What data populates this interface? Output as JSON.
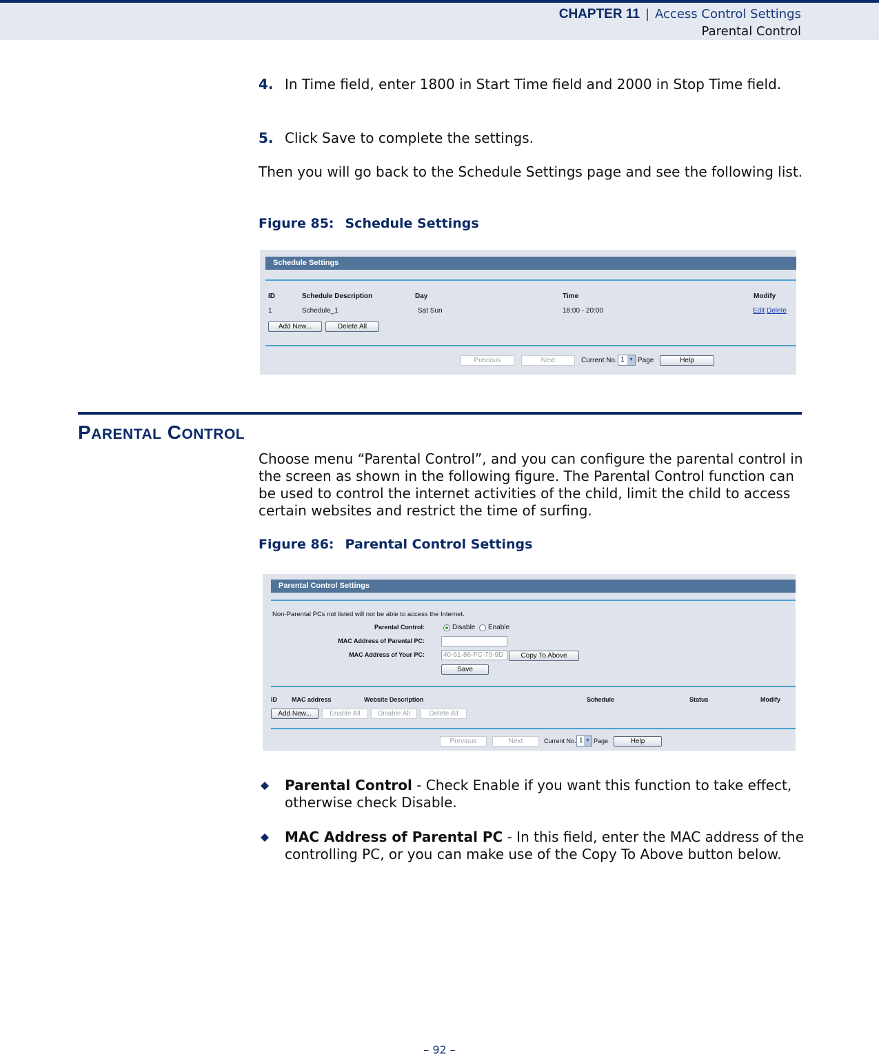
{
  "header": {
    "chapter_label": "Chapter",
    "chapter_number": "11",
    "separator": "|",
    "section": "Access Control Settings",
    "subsection": "Parental Control"
  },
  "steps": [
    {
      "number": "4.",
      "text": "In Time field, enter 1800 in Start Time field and 2000 in Stop Time field."
    },
    {
      "number": "5.",
      "text": "Click Save to complete the settings."
    }
  ],
  "intro_paragraph": "Then you will go back to the Schedule Settings page and see the following list.",
  "figure85": {
    "label": "Figure 85:",
    "title": "Schedule Settings",
    "panel_title": "Schedule Settings",
    "columns": [
      "ID",
      "Schedule Description",
      "Day",
      "Time",
      "Modify"
    ],
    "rows": [
      {
        "id": "1",
        "description": "Schedule_1",
        "day": "Sat Sun",
        "time": "18:00 - 20:00",
        "edit": "Edit",
        "delete": "Delete"
      }
    ],
    "buttons": {
      "add_new": "Add New...",
      "delete_all": "Delete All"
    },
    "pager": {
      "previous": "Previous",
      "next": "Next",
      "current_no": "Current No.",
      "page_value": "1",
      "page": "Page",
      "help": "Help"
    }
  },
  "section": {
    "title_first": "P",
    "title_first_rest": "ARENTAL",
    "title_second": "C",
    "title_second_rest": "ONTROL",
    "paragraph": "Choose menu “Parental Control”, and you can configure the parental control in the screen as shown in the following figure. The Parental Control function can be used to control the internet activities of the child, limit the child to access certain websites and restrict the time of surfing."
  },
  "figure86": {
    "label": "Figure 86:",
    "title": "Parental Control Settings",
    "panel_title": "Parental Control Settings",
    "notice": "Non-Parental PCs not listed will not be able to access the Internet.",
    "fields": {
      "parental_control_label": "Parental Control:",
      "disable_label": "Disable",
      "enable_label": "Enable",
      "selected": "Disable",
      "mac_parental_label": "MAC Address of Parental PC:",
      "mac_parental_value": "",
      "mac_your_label": "MAC Address of Your PC:",
      "mac_your_value": "40-61-86-FC-70-9D",
      "copy_button": "Copy To Above",
      "save_button": "Save"
    },
    "columns": [
      "ID",
      "MAC address",
      "Website Description",
      "Schedule",
      "Status",
      "Modify"
    ],
    "buttons": {
      "add_new": "Add New...",
      "enable_all": "Enable All",
      "disable_all": "Disable All",
      "delete_all": "Delete All"
    },
    "pager": {
      "previous": "Previous",
      "next": "Next",
      "current_no": "Current No.",
      "page_value": "1",
      "page": "Page",
      "help": "Help"
    }
  },
  "bullets": [
    {
      "term": "Parental Control",
      "text": " - Check Enable if you want this function to take effect, otherwise check Disable."
    },
    {
      "term": "MAC Address of Parental PC",
      "text": " - In this field, enter the MAC address of the controlling PC, or you can make use of the Copy To Above button below."
    }
  ],
  "page_number": "–  92  –"
}
